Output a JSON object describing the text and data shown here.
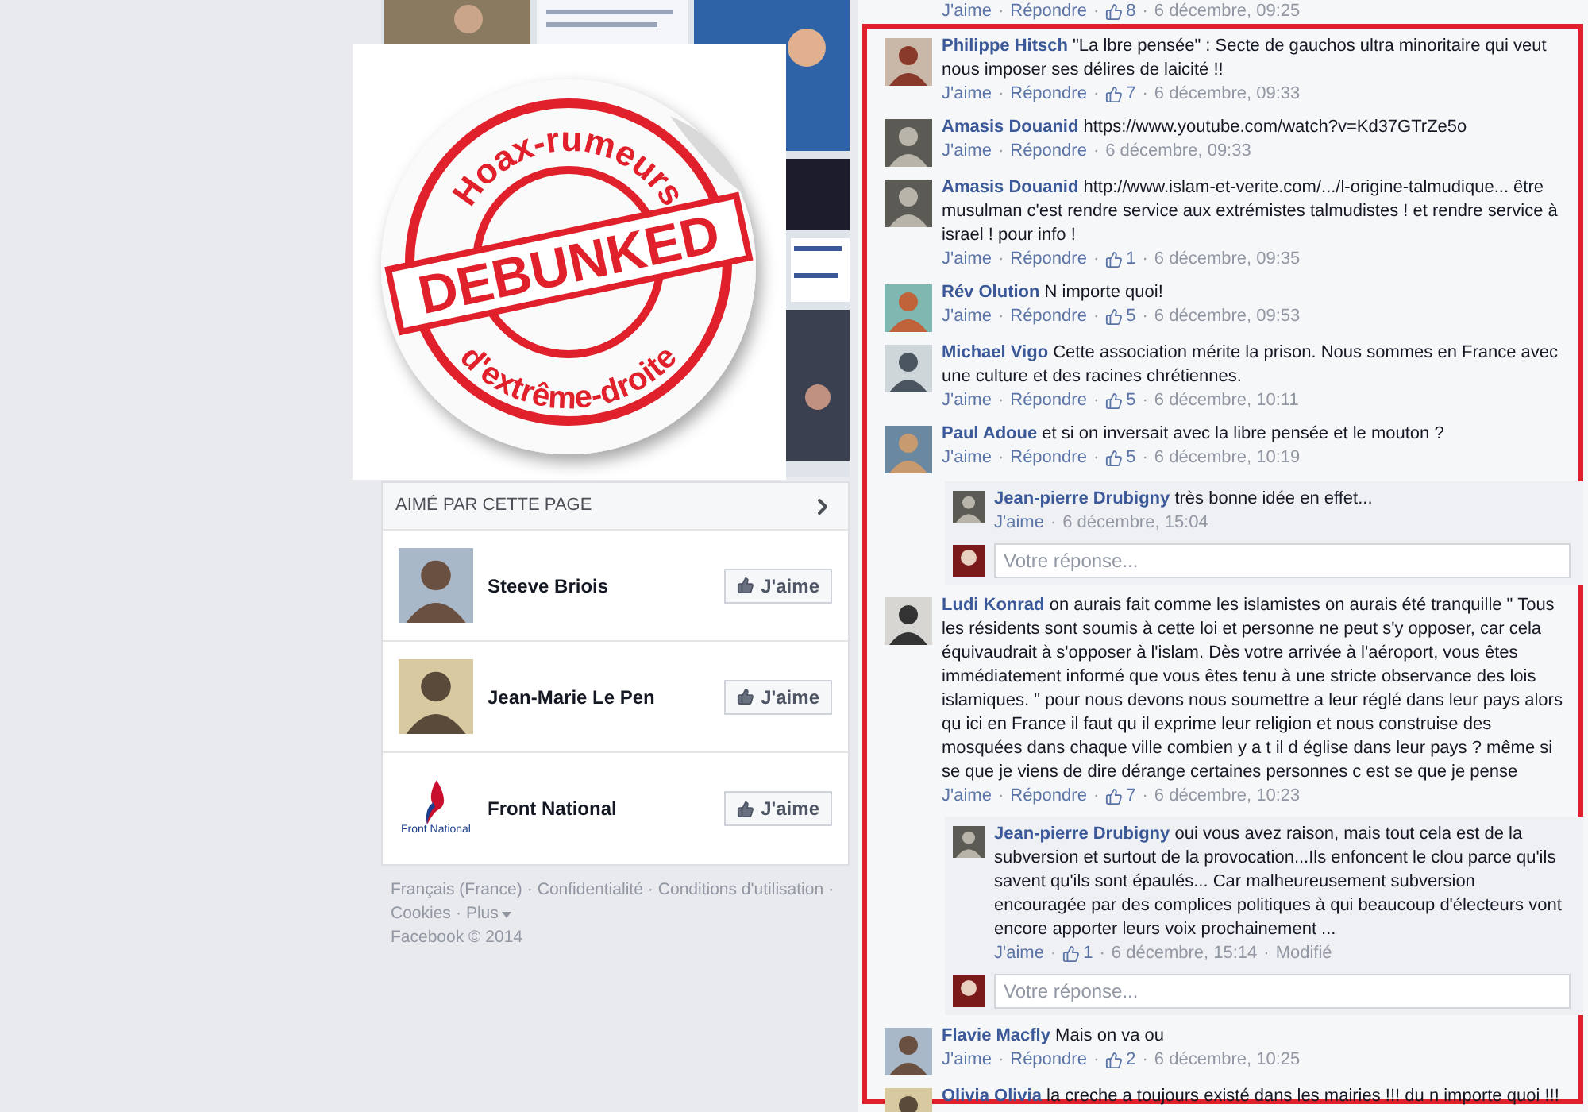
{
  "separator": "·",
  "sticker": {
    "top_text": "Hoax-rumeurs",
    "band_text": "DEBUNKED",
    "bottom_text": "d'extrême-droite"
  },
  "liked_by": {
    "title": "AIMÉ PAR CETTE PAGE",
    "pages": [
      {
        "name": "Steeve Briois",
        "button": "J'aime"
      },
      {
        "name": "Jean-Marie Le Pen",
        "button": "J'aime"
      },
      {
        "name": "Front National",
        "button": "J'aime",
        "logo_text": "Front National"
      }
    ]
  },
  "footer": {
    "links": [
      "Français (France)",
      "Confidentialité",
      "Conditions d'utilisation",
      "Cookies",
      "Plus"
    ],
    "copyright": "Facebook © 2014"
  },
  "top_actions": {
    "like": "J'aime",
    "reply": "Répondre",
    "likes": "8",
    "time": "6 décembre, 09:25"
  },
  "comments": [
    {
      "author": "Philippe Hitsch",
      "text": "\"La lbre pensée\" : Secte de gauchos ultra minoritaire qui veut nous imposer ses délires de laicité !!",
      "actions": {
        "like": "J'aime",
        "reply": "Répondre",
        "likes": "7",
        "time": "6 décembre, 09:33"
      }
    },
    {
      "author": "Amasis Douanid",
      "text": "https://www.youtube.com/watch?v=Kd37GTrZe5o",
      "actions": {
        "like": "J'aime",
        "reply": "Répondre",
        "time": "6 décembre, 09:33"
      }
    },
    {
      "author": "Amasis Douanid",
      "text": "http://www.islam-et-verite.com/.../l-origine-talmudique... être musulman c'est rendre service aux extrémistes talmudistes ! et rendre service à israel ! pour info !",
      "actions": {
        "like": "J'aime",
        "reply": "Répondre",
        "likes": "1",
        "time": "6 décembre, 09:35"
      }
    },
    {
      "author": "Rév Olution",
      "text": "N importe quoi!",
      "actions": {
        "like": "J'aime",
        "reply": "Répondre",
        "likes": "5",
        "time": "6 décembre, 09:53"
      }
    },
    {
      "author": "Michael Vigo",
      "text": "Cette association mérite la prison. Nous sommes en France avec une culture et des racines chrétiennes.",
      "actions": {
        "like": "J'aime",
        "reply": "Répondre",
        "likes": "5",
        "time": "6 décembre, 10:11"
      }
    },
    {
      "author": "Paul Adoue",
      "text": "et si on inversait avec la libre pensée et le mouton ?",
      "actions": {
        "like": "J'aime",
        "reply": "Répondre",
        "likes": "5",
        "time": "6 décembre, 10:19"
      },
      "replies": [
        {
          "author": "Jean-pierre Drubigny",
          "text": "très bonne idée en effet...",
          "actions": {
            "like": "J'aime",
            "time": "6 décembre, 15:04"
          }
        }
      ],
      "reply_field": {
        "placeholder": "Votre réponse..."
      }
    },
    {
      "author": "Ludi Konrad",
      "text": "on aurais fait comme les islamistes on aurais été tranquille \" Tous les résidents sont soumis à cette loi et personne ne peut s'y opposer, car cela équivaudrait à s'opposer à l'islam. Dès votre arrivée à l'aéroport, vous êtes immédiatement informé que vous êtes tenu à une stricte observance des lois islamiques. \" pour nous devons nous soumettre a leur réglé dans leur pays alors qu ici en France il faut qu il exprime leur religion et nous construise des mosquées dans chaque ville combien y a t il d église dans leur pays ? même si se que je viens de dire dérange certaines personnes c est se que je pense",
      "actions": {
        "like": "J'aime",
        "reply": "Répondre",
        "likes": "7",
        "time": "6 décembre, 10:23"
      },
      "replies": [
        {
          "author": "Jean-pierre Drubigny",
          "text": "oui vous avez raison, mais tout cela est de la subversion et surtout de la provocation...Ils enfoncent le clou parce qu'ils savent qu'ils sont épaulés... Car malheureusement subversion encouragée par des complices politiques à qui beaucoup d'électeurs vont encore apporter leurs voix prochainement ...",
          "actions": {
            "like": "J'aime",
            "likes": "1",
            "time": "6 décembre, 15:14",
            "edited": "Modifié"
          }
        }
      ],
      "reply_field": {
        "placeholder": "Votre réponse..."
      }
    },
    {
      "author": "Flavie Macfly",
      "text": "Mais on va ou",
      "actions": {
        "like": "J'aime",
        "reply": "Répondre",
        "likes": "2",
        "time": "6 décembre, 10:25"
      }
    },
    {
      "author": "Olivia Olivia",
      "text": "la creche a toujours existé dans les mairies !!! du n importe quoi !!!"
    }
  ]
}
